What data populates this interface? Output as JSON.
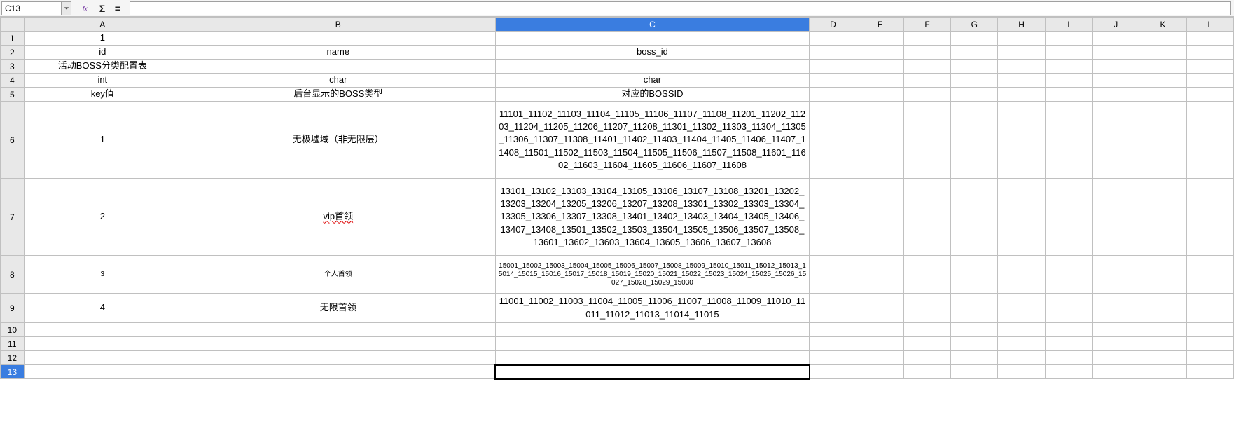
{
  "toolbar": {
    "cell_ref": "C13",
    "formula": ""
  },
  "columns": [
    "A",
    "B",
    "C",
    "D",
    "E",
    "F",
    "G",
    "H",
    "I",
    "J",
    "K",
    "L"
  ],
  "selected_col": "C",
  "selected_row": 13,
  "rows": [
    {
      "n": 1,
      "h": "reg",
      "A": "1",
      "B": "",
      "C": ""
    },
    {
      "n": 2,
      "h": "reg",
      "A": "id",
      "B": "name",
      "C": "boss_id"
    },
    {
      "n": 3,
      "h": "reg",
      "A": "活动BOSS分类配置表",
      "B": "",
      "C": ""
    },
    {
      "n": 4,
      "h": "reg",
      "A": "int",
      "B": "char",
      "C": "char"
    },
    {
      "n": 5,
      "h": "reg",
      "A": "key值",
      "B": "后台显示的BOSS类型",
      "C": "对应的BOSSID"
    },
    {
      "n": 6,
      "h": "tall1",
      "A": "1",
      "B": "无极墟域（非无限层）",
      "C": "11101_11102_11103_11104_11105_11106_11107_11108_11201_11202_11203_11204_11205_11206_11207_11208_11301_11302_11303_11304_11305_11306_11307_11308_11401_11402_11403_11404_11405_11406_11407_11408_11501_11502_11503_11504_11505_11506_11507_11508_11601_11602_11603_11604_11605_11606_11607_11608"
    },
    {
      "n": 7,
      "h": "tall2",
      "A": "2",
      "B": "vip首领",
      "B_err": true,
      "C": "13101_13102_13103_13104_13105_13106_13107_13108_13201_13202_13203_13204_13205_13206_13207_13208_13301_13302_13303_13304_13305_13306_13307_13308_13401_13402_13403_13404_13405_13406_13407_13408_13501_13502_13503_13504_13505_13506_13507_13508_13601_13602_13603_13604_13605_13606_13607_13608"
    },
    {
      "n": 8,
      "h": "mid1",
      "A": "3",
      "B": "个人首领",
      "flag": true,
      "C": "15001_15002_15003_15004_15005_15006_15007_15008_15009_15010_15011_15012_15013_15014_15015_15016_15017_15018_15019_15020_15021_15022_15023_15024_15025_15026_15027_15028_15029_15030"
    },
    {
      "n": 9,
      "h": "mid2",
      "A": "4",
      "B": "无限首领",
      "C": "11001_11002_11003_11004_11005_11006_11007_11008_11009_11010_11011_11012_11013_11014_11015"
    },
    {
      "n": 10,
      "h": "reg",
      "A": "",
      "B": "",
      "C": ""
    },
    {
      "n": 11,
      "h": "reg",
      "A": "",
      "B": "",
      "C": ""
    },
    {
      "n": 12,
      "h": "reg",
      "A": "",
      "B": "",
      "C": ""
    },
    {
      "n": 13,
      "h": "reg",
      "A": "",
      "B": "",
      "C": "",
      "active": true
    }
  ],
  "chart_data": {
    "type": "table",
    "title": "活动BOSS分类配置表",
    "columns": [
      "id",
      "name",
      "boss_id"
    ],
    "types": [
      "int",
      "char",
      "char"
    ],
    "labels": [
      "key值",
      "后台显示的BOSS类型",
      "对应的BOSSID"
    ],
    "rows": [
      {
        "id": 1,
        "name": "无极墟域（非无限层）",
        "boss_id": "11101_11102_11103_11104_11105_11106_11107_11108_11201_11202_11203_11204_11205_11206_11207_11208_11301_11302_11303_11304_11305_11306_11307_11308_11401_11402_11403_11404_11405_11406_11407_11408_11501_11502_11503_11504_11505_11506_11507_11508_11601_11602_11603_11604_11605_11606_11607_11608"
      },
      {
        "id": 2,
        "name": "vip首领",
        "boss_id": "13101_13102_13103_13104_13105_13106_13107_13108_13201_13202_13203_13204_13205_13206_13207_13208_13301_13302_13303_13304_13305_13306_13307_13308_13401_13402_13403_13404_13405_13406_13407_13408_13501_13502_13503_13504_13505_13506_13507_13508_13601_13602_13603_13604_13605_13606_13607_13608"
      },
      {
        "id": 3,
        "name": "个人首领",
        "boss_id": "15001_15002_15003_15004_15005_15006_15007_15008_15009_15010_15011_15012_15013_15014_15015_15016_15017_15018_15019_15020_15021_15022_15023_15024_15025_15026_15027_15028_15029_15030"
      },
      {
        "id": 4,
        "name": "无限首领",
        "boss_id": "11001_11002_11003_11004_11005_11006_11007_11008_11009_11010_11011_11012_11013_11014_11015"
      }
    ]
  }
}
